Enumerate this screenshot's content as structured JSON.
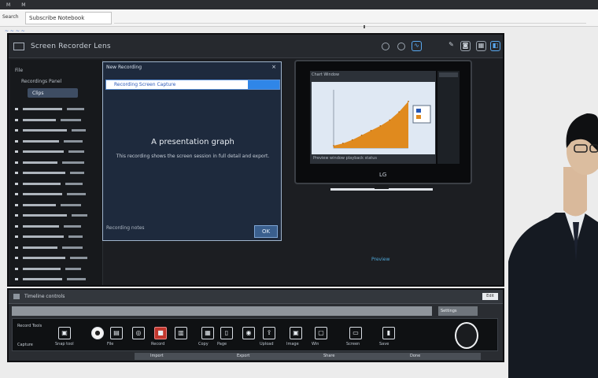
{
  "browser": {
    "tab_icons": [
      "M",
      "M"
    ],
    "left_label": "Search",
    "address": "Subscribe Notebook",
    "link": "~ ~ ~ ~"
  },
  "app": {
    "title": "Screen Recorder Lens",
    "header_icons": [
      "settings-icon",
      "record-icon",
      "link-icon",
      "pen-icon",
      "camera-icon",
      "share-icon"
    ]
  },
  "sidebar": {
    "heading": "File",
    "subheading": "Recordings Panel",
    "selected": "Clips",
    "rows": [
      {
        "w1": 50,
        "w2": 22
      },
      {
        "w1": 42,
        "w2": 26
      },
      {
        "w1": 56,
        "w2": 18
      },
      {
        "w1": 46,
        "w2": 24
      },
      {
        "w1": 52,
        "w2": 20
      },
      {
        "w1": 44,
        "w2": 28
      },
      {
        "w1": 54,
        "w2": 18
      },
      {
        "w1": 48,
        "w2": 22
      },
      {
        "w1": 50,
        "w2": 24
      },
      {
        "w1": 42,
        "w2": 26
      },
      {
        "w1": 56,
        "w2": 20
      },
      {
        "w1": 46,
        "w2": 22
      },
      {
        "w1": 52,
        "w2": 18
      },
      {
        "w1": 44,
        "w2": 26
      },
      {
        "w1": 54,
        "w2": 22
      },
      {
        "w1": 48,
        "w2": 20
      },
      {
        "w1": 50,
        "w2": 24
      },
      {
        "w1": 42,
        "w2": 18
      }
    ]
  },
  "dialog": {
    "title": "New Recording",
    "close": "×",
    "field_value": "Recording Screen Capture",
    "headline": "A presentation graph",
    "subline": "This recording shows the screen session in full detail and export.",
    "footer": "Recording notes",
    "ok_label": "OK"
  },
  "monitor": {
    "screen_title": "Chart Window",
    "footer": "Preview window playback status",
    "logo": "LG",
    "chart_data": {
      "type": "area",
      "x": [
        0,
        1,
        2,
        3,
        4,
        5,
        6,
        7,
        8
      ],
      "values": [
        4,
        8,
        14,
        22,
        30,
        38,
        48,
        62,
        80
      ],
      "ylim": [
        0,
        100
      ]
    }
  },
  "caption": "Preview",
  "strip": {
    "label": "Timeline controls",
    "right_btn": "Edit",
    "side_label": "Settings",
    "tray_label": "Record Tools",
    "tray_label2": "Capture",
    "tools": [
      {
        "name": "camera-tool-icon",
        "glyph": "▣",
        "cap": "Snap tool"
      },
      {
        "name": "circle-tool-icon",
        "glyph": "●",
        "cap": "",
        "style": "circle"
      },
      {
        "name": "file-tool-icon",
        "glyph": "▤",
        "cap": "File"
      },
      {
        "name": "target-tool-icon",
        "glyph": "◎",
        "cap": ""
      },
      {
        "name": "record-tool-icon",
        "glyph": "■",
        "cap": "Record",
        "style": "red"
      },
      {
        "name": "doc-tool-icon",
        "glyph": "▥",
        "cap": ""
      },
      {
        "name": "copy-tool-icon",
        "glyph": "▦",
        "cap": "Copy"
      },
      {
        "name": "page-tool-icon",
        "glyph": "▯",
        "cap": "Page"
      },
      {
        "name": "disc-tool-icon",
        "glyph": "◉",
        "cap": ""
      },
      {
        "name": "upload-tool-icon",
        "glyph": "⇪",
        "cap": "Upload"
      },
      {
        "name": "image-tool-icon",
        "glyph": "▣",
        "cap": "Image"
      },
      {
        "name": "window-tool-icon",
        "glyph": "▢",
        "cap": "Win"
      },
      {
        "name": "screen-tool-icon",
        "glyph": "▭",
        "cap": "Screen"
      },
      {
        "name": "bookmark-tool-icon",
        "glyph": "▮",
        "cap": "Save"
      }
    ],
    "footer_items": [
      "Import",
      "Export",
      "Share",
      "Done"
    ]
  }
}
